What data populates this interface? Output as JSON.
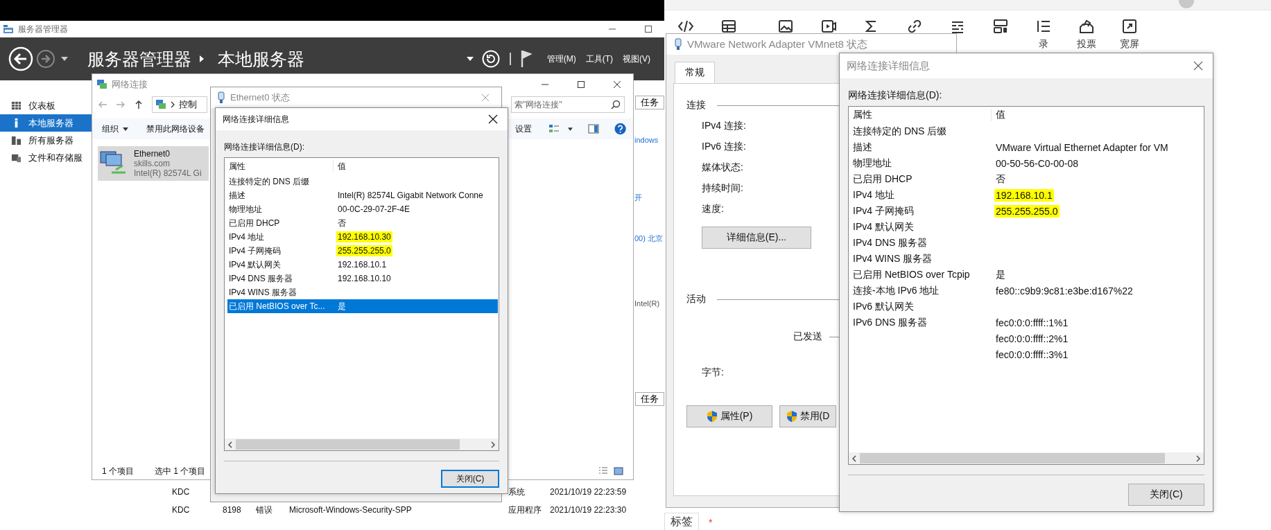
{
  "server_manager": {
    "title": "服务器管理器",
    "breadcrumb": [
      "服务器管理器",
      "本地服务器"
    ],
    "menu": [
      "管理(M)",
      "工具(T)",
      "视图(V)"
    ],
    "sidebar": [
      {
        "label": "仪表板",
        "kind": "dashboard",
        "selected": false
      },
      {
        "label": "本地服务器",
        "kind": "server",
        "selected": true
      },
      {
        "label": "所有服务器",
        "kind": "servers",
        "selected": false
      },
      {
        "label": "文件和存储服",
        "kind": "files",
        "selected": false
      }
    ],
    "task_buttons": [
      "任务",
      "任务"
    ],
    "fragments": [
      {
        "text": "indows",
        "kind": "link"
      },
      {
        "text": "开",
        "kind": "link"
      },
      {
        "text": "00) 北京",
        "kind": "link"
      },
      {
        "text": "Intel(R)",
        "kind": "plain"
      }
    ],
    "events": [
      {
        "server": "KDC",
        "type": "系统",
        "time": "2021/10/19 22:23:59"
      },
      {
        "server": "KDC",
        "id": "8198",
        "level": "错误",
        "source": "Microsoft-Windows-Security-SPP",
        "type": "应用程序",
        "time": "2021/10/19 22:23:30"
      }
    ]
  },
  "network_connections": {
    "title": "网络连接",
    "address": "控制",
    "search_placeholder": "索\"网络连接\"",
    "toolbar": [
      {
        "label": "组织",
        "dropdown": true
      },
      {
        "label": "禁用此网络设备",
        "dropdown": false
      },
      {
        "label": "设置",
        "dropdown": false
      }
    ],
    "adapter": {
      "name": "Ethernet0",
      "domain": "skills.com",
      "device": "Intel(R) 82574L Gi",
      "selected": true
    },
    "status": [
      "1 个项目",
      "选中 1 个项目"
    ]
  },
  "ethernet_status": {
    "title": "Ethernet0 状态"
  },
  "details_left": {
    "title": "网络连接详细信息",
    "active": true,
    "label": "网络连接详细信息(D):",
    "columns": [
      "属性",
      "值"
    ],
    "rows": [
      {
        "property": "连接特定的 DNS 后缀",
        "highlighted": false,
        "selected": false
      },
      {
        "property": "描述",
        "value": "Intel(R) 82574L Gigabit Network Conne",
        "highlighted": false,
        "selected": false
      },
      {
        "property": "物理地址",
        "value": "00-0C-29-07-2F-4E",
        "highlighted": false,
        "selected": false
      },
      {
        "property": "已启用 DHCP",
        "value": "否",
        "highlighted": false,
        "selected": false
      },
      {
        "property": "IPv4 地址",
        "value": "192.168.10.30",
        "highlighted": true,
        "selected": false
      },
      {
        "property": "IPv4 子网掩码",
        "value": "255.255.255.0",
        "highlighted": true,
        "selected": false
      },
      {
        "property": "IPv4 默认网关",
        "value": "192.168.10.1",
        "highlighted": false,
        "selected": false
      },
      {
        "property": "IPv4 DNS 服务器",
        "value": "192.168.10.10",
        "highlighted": false,
        "selected": false
      },
      {
        "property": "IPv4 WINS 服务器",
        "highlighted": false,
        "selected": false
      },
      {
        "property": "已启用 NetBIOS over Tc...",
        "value": "是",
        "highlighted": false,
        "selected": true
      }
    ],
    "close": "关闭(C)"
  },
  "editor": {
    "toolbar": [
      {
        "kind": "code"
      },
      {
        "kind": "table"
      },
      {
        "kind": "image"
      },
      {
        "kind": "video"
      },
      {
        "kind": "sigma"
      },
      {
        "kind": "link"
      },
      {
        "kind": "list"
      },
      {
        "kind": "layout"
      },
      {
        "kind": "toc",
        "label": "录"
      },
      {
        "kind": "vote",
        "label": "投票"
      },
      {
        "kind": "fullscreen",
        "label": "宽屏"
      }
    ],
    "tags_label": "标签",
    "required_mark": "*"
  },
  "vmware_status": {
    "title": "VMware Network Adapter VMnet8 状态",
    "tabs": [
      {
        "label": "常规",
        "selected": true
      }
    ],
    "connection_heading": "连接",
    "fields": [
      "IPv4 连接:",
      "IPv6 连接:",
      "媒体状态:",
      "持续时间:",
      "速度:"
    ],
    "details_button": "详细信息(E)...",
    "activity_heading": "活动",
    "sent": "已发送",
    "bytes": "字节:",
    "buttons": [
      {
        "label": "属性(P)",
        "shield": true
      },
      {
        "label": "禁用(D",
        "shield": true
      }
    ]
  },
  "details_right": {
    "title": "网络连接详细信息",
    "active": false,
    "label": "网络连接详细信息(D):",
    "columns": [
      "属性",
      "值"
    ],
    "rows": [
      {
        "property": "连接特定的 DNS 后缀",
        "highlighted": false,
        "selected": false
      },
      {
        "property": "描述",
        "value": "VMware Virtual Ethernet Adapter for VM",
        "highlighted": false,
        "selected": false
      },
      {
        "property": "物理地址",
        "value": "00-50-56-C0-00-08",
        "highlighted": false,
        "selected": false
      },
      {
        "property": "已启用 DHCP",
        "value": "否",
        "highlighted": false,
        "selected": false
      },
      {
        "property": "IPv4 地址",
        "value": "192.168.10.1",
        "highlighted": true,
        "selected": false
      },
      {
        "property": "IPv4 子网掩码",
        "value": "255.255.255.0",
        "highlighted": true,
        "selected": false
      },
      {
        "property": "IPv4 默认网关",
        "highlighted": false,
        "selected": false
      },
      {
        "property": "IPv4 DNS 服务器",
        "highlighted": false,
        "selected": false
      },
      {
        "property": "IPv4 WINS 服务器",
        "highlighted": false,
        "selected": false
      },
      {
        "property": "已启用 NetBIOS over Tcpip",
        "value": "是",
        "highlighted": false,
        "selected": false
      },
      {
        "property": "连接-本地 IPv6 地址",
        "value": "fe80::c9b9:9c81:e3be:d167%22",
        "highlighted": false,
        "selected": false
      },
      {
        "property": "IPv6 默认网关",
        "highlighted": false,
        "selected": false
      },
      {
        "property": "IPv6 DNS 服务器",
        "value": "fec0:0:0:ffff::1%1",
        "highlighted": false,
        "selected": false
      },
      {
        "value": "fec0:0:0:ffff::2%1",
        "highlighted": false,
        "selected": false
      },
      {
        "value": "fec0:0:0:ffff::3%1",
        "highlighted": false,
        "selected": false
      }
    ],
    "close": "关闭(C)"
  }
}
